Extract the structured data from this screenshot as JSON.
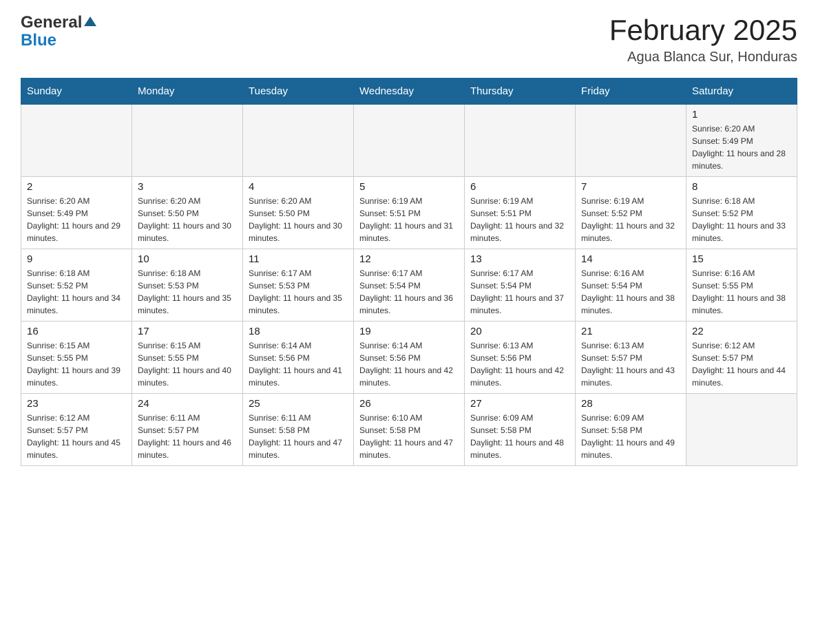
{
  "header": {
    "logo_general": "General",
    "logo_blue": "Blue",
    "month_title": "February 2025",
    "location": "Agua Blanca Sur, Honduras"
  },
  "days_of_week": [
    "Sunday",
    "Monday",
    "Tuesday",
    "Wednesday",
    "Thursday",
    "Friday",
    "Saturday"
  ],
  "weeks": [
    [
      {
        "day": "",
        "info": ""
      },
      {
        "day": "",
        "info": ""
      },
      {
        "day": "",
        "info": ""
      },
      {
        "day": "",
        "info": ""
      },
      {
        "day": "",
        "info": ""
      },
      {
        "day": "",
        "info": ""
      },
      {
        "day": "1",
        "info": "Sunrise: 6:20 AM\nSunset: 5:49 PM\nDaylight: 11 hours and 28 minutes."
      }
    ],
    [
      {
        "day": "2",
        "info": "Sunrise: 6:20 AM\nSunset: 5:49 PM\nDaylight: 11 hours and 29 minutes."
      },
      {
        "day": "3",
        "info": "Sunrise: 6:20 AM\nSunset: 5:50 PM\nDaylight: 11 hours and 30 minutes."
      },
      {
        "day": "4",
        "info": "Sunrise: 6:20 AM\nSunset: 5:50 PM\nDaylight: 11 hours and 30 minutes."
      },
      {
        "day": "5",
        "info": "Sunrise: 6:19 AM\nSunset: 5:51 PM\nDaylight: 11 hours and 31 minutes."
      },
      {
        "day": "6",
        "info": "Sunrise: 6:19 AM\nSunset: 5:51 PM\nDaylight: 11 hours and 32 minutes."
      },
      {
        "day": "7",
        "info": "Sunrise: 6:19 AM\nSunset: 5:52 PM\nDaylight: 11 hours and 32 minutes."
      },
      {
        "day": "8",
        "info": "Sunrise: 6:18 AM\nSunset: 5:52 PM\nDaylight: 11 hours and 33 minutes."
      }
    ],
    [
      {
        "day": "9",
        "info": "Sunrise: 6:18 AM\nSunset: 5:52 PM\nDaylight: 11 hours and 34 minutes."
      },
      {
        "day": "10",
        "info": "Sunrise: 6:18 AM\nSunset: 5:53 PM\nDaylight: 11 hours and 35 minutes."
      },
      {
        "day": "11",
        "info": "Sunrise: 6:17 AM\nSunset: 5:53 PM\nDaylight: 11 hours and 35 minutes."
      },
      {
        "day": "12",
        "info": "Sunrise: 6:17 AM\nSunset: 5:54 PM\nDaylight: 11 hours and 36 minutes."
      },
      {
        "day": "13",
        "info": "Sunrise: 6:17 AM\nSunset: 5:54 PM\nDaylight: 11 hours and 37 minutes."
      },
      {
        "day": "14",
        "info": "Sunrise: 6:16 AM\nSunset: 5:54 PM\nDaylight: 11 hours and 38 minutes."
      },
      {
        "day": "15",
        "info": "Sunrise: 6:16 AM\nSunset: 5:55 PM\nDaylight: 11 hours and 38 minutes."
      }
    ],
    [
      {
        "day": "16",
        "info": "Sunrise: 6:15 AM\nSunset: 5:55 PM\nDaylight: 11 hours and 39 minutes."
      },
      {
        "day": "17",
        "info": "Sunrise: 6:15 AM\nSunset: 5:55 PM\nDaylight: 11 hours and 40 minutes."
      },
      {
        "day": "18",
        "info": "Sunrise: 6:14 AM\nSunset: 5:56 PM\nDaylight: 11 hours and 41 minutes."
      },
      {
        "day": "19",
        "info": "Sunrise: 6:14 AM\nSunset: 5:56 PM\nDaylight: 11 hours and 42 minutes."
      },
      {
        "day": "20",
        "info": "Sunrise: 6:13 AM\nSunset: 5:56 PM\nDaylight: 11 hours and 42 minutes."
      },
      {
        "day": "21",
        "info": "Sunrise: 6:13 AM\nSunset: 5:57 PM\nDaylight: 11 hours and 43 minutes."
      },
      {
        "day": "22",
        "info": "Sunrise: 6:12 AM\nSunset: 5:57 PM\nDaylight: 11 hours and 44 minutes."
      }
    ],
    [
      {
        "day": "23",
        "info": "Sunrise: 6:12 AM\nSunset: 5:57 PM\nDaylight: 11 hours and 45 minutes."
      },
      {
        "day": "24",
        "info": "Sunrise: 6:11 AM\nSunset: 5:57 PM\nDaylight: 11 hours and 46 minutes."
      },
      {
        "day": "25",
        "info": "Sunrise: 6:11 AM\nSunset: 5:58 PM\nDaylight: 11 hours and 47 minutes."
      },
      {
        "day": "26",
        "info": "Sunrise: 6:10 AM\nSunset: 5:58 PM\nDaylight: 11 hours and 47 minutes."
      },
      {
        "day": "27",
        "info": "Sunrise: 6:09 AM\nSunset: 5:58 PM\nDaylight: 11 hours and 48 minutes."
      },
      {
        "day": "28",
        "info": "Sunrise: 6:09 AM\nSunset: 5:58 PM\nDaylight: 11 hours and 49 minutes."
      },
      {
        "day": "",
        "info": ""
      }
    ]
  ]
}
